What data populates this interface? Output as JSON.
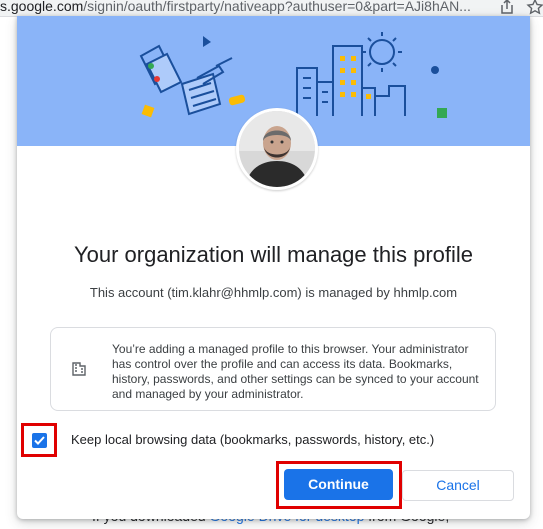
{
  "browser": {
    "url_host": "s.google.com",
    "url_path": "/signin/oauth/firstparty/nativeapp?authuser=0&part=AJi8hAN..."
  },
  "background_page": {
    "text_before": "If you downloaded ",
    "link_text": "Google Drive for desktop",
    "text_after": " from Google,"
  },
  "dialog": {
    "title": "Your organization will manage this profile",
    "subtitle": "This account (tim.klahr@hhmlp.com) is managed by hhmlp.com",
    "info_icon": "building-icon",
    "info_text": "You’re adding a managed profile to this browser. Your administrator has control over the profile and can access its data. Bookmarks, history, passwords, and other settings can be synced to your account and managed by your administrator.",
    "checkbox_label": "Keep local browsing data (bookmarks, passwords, history, etc.)",
    "checkbox_checked": true,
    "continue_label": "Continue",
    "cancel_label": "Cancel"
  },
  "colors": {
    "banner": "#8ab4f8",
    "primary": "#1a73e8",
    "highlight": "#e00000"
  }
}
